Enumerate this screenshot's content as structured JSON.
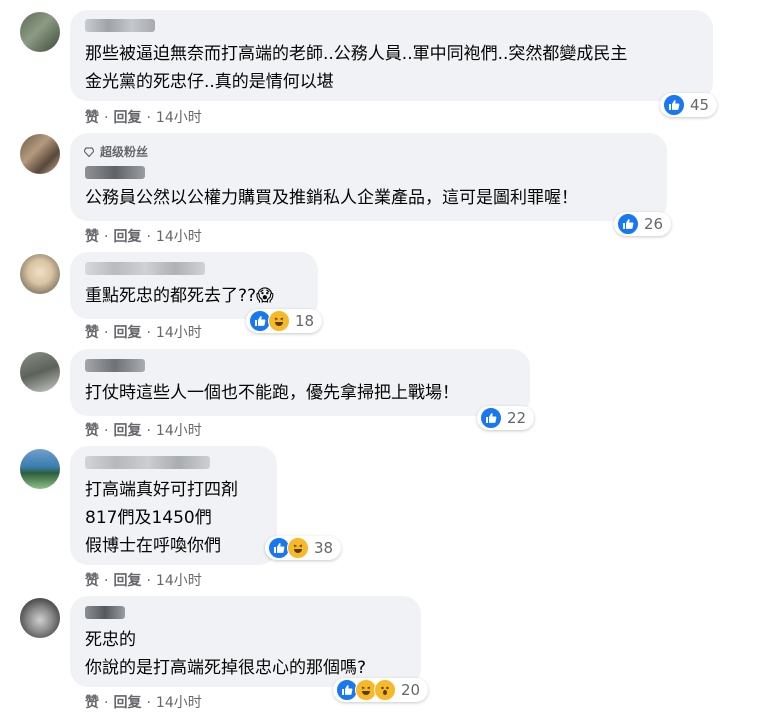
{
  "comments": [
    {
      "text": "那些被逼迫無奈而打高端的老師..公務人員..軍中同袍們..突然都變成民主\n金光黨的死忠仔..真的是情何以堪",
      "reactions": [
        "like"
      ],
      "count": "45",
      "like": "赞",
      "reply": "回复",
      "time": "14小时"
    },
    {
      "badge": "超级粉丝",
      "text": "公務員公然以公權力購買及推銷私人企業產品，這可是圖利罪喔！",
      "reactions": [
        "like"
      ],
      "count": "26",
      "like": "赞",
      "reply": "回复",
      "time": "14小时"
    },
    {
      "text": "重點死忠的都死去了??😱",
      "reactions": [
        "like",
        "haha"
      ],
      "count": "18",
      "like": "赞",
      "reply": "回复",
      "time": "14小时"
    },
    {
      "text": "打仗時這些人一個也不能跑，優先拿掃把上戰場！",
      "reactions": [
        "like"
      ],
      "count": "22",
      "like": "赞",
      "reply": "回复",
      "time": "14小时"
    },
    {
      "text": "打高端真好可打四剤\n817們及1450們\n假博士在呼喚你們",
      "reactions": [
        "like",
        "haha"
      ],
      "count": "38",
      "like": "赞",
      "reply": "回复",
      "time": "14小时"
    },
    {
      "text": "死忠的\n你說的是打高端死掉很忠心的那個嗎?",
      "reactions": [
        "like",
        "haha",
        "wow"
      ],
      "count": "20",
      "like": "赞",
      "reply": "回复",
      "time": "14小时"
    }
  ],
  "colors": {
    "bubble": "#f0f2f5",
    "like_blue": "#1877f2",
    "haha_yellow": "#f7b928",
    "meta_gray": "#65676b"
  }
}
